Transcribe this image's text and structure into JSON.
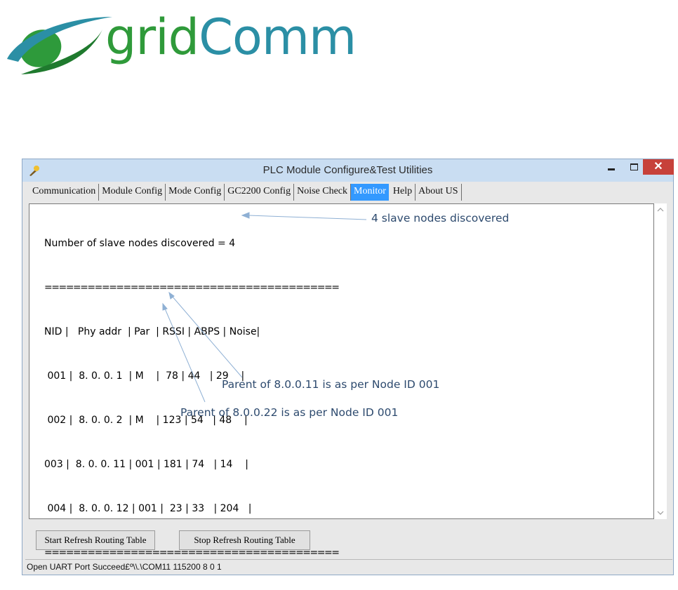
{
  "logo": {
    "word_a": "grid",
    "word_b": "Comm",
    "color_a": "#2f9a3a",
    "color_b": "#2b8fa5",
    "icon": "swoosh-globe-icon"
  },
  "window": {
    "title": "PLC Module Configure&Test Utilities",
    "close_glyph": "✕"
  },
  "tabs": [
    {
      "label": "Communication"
    },
    {
      "label": "Module Config"
    },
    {
      "label": "Mode Config"
    },
    {
      "label": "GC2200 Config"
    },
    {
      "label": "Noise Check"
    },
    {
      "label": "Monitor",
      "active": true
    },
    {
      "label": "Help"
    },
    {
      "label": "About US"
    }
  ],
  "console": {
    "summary": "Number of slave nodes discovered = 4",
    "separator": "=========================================",
    "header": "NID |   Phy addr  | Par  | RSSI | ABPS | Noise|",
    "rows": [
      " 001 |  8. 0. 0. 1  | M    |  78 | 44   | 29    |",
      " 002 |  8. 0. 0. 2  | M    | 123 | 54   | 48    |",
      "003 |  8. 0. 0. 11 | 001 | 181 | 74   | 14    |",
      " 004 |  8. 0. 0. 12 | 001 |  23 | 33   | 204   |"
    ]
  },
  "annotations": {
    "nodes_discovered": "4 slave nodes discovered",
    "parent_11": "Parent of 8.0.0.11 is as per Node ID 001",
    "parent_22": "Parent of 8.0.0.22 is as per Node ID 001"
  },
  "buttons": {
    "start": "Start Refresh Routing Table",
    "stop": "Stop Refresh Routing Table"
  },
  "status": "Open UART Port Succeed£º\\\\.\\COM11 115200 8 0 1",
  "colors": {
    "accent": "#3399ff",
    "close": "#c7413a",
    "titlebar": "#c9ddf2",
    "annotation": "#2d4a6e"
  }
}
